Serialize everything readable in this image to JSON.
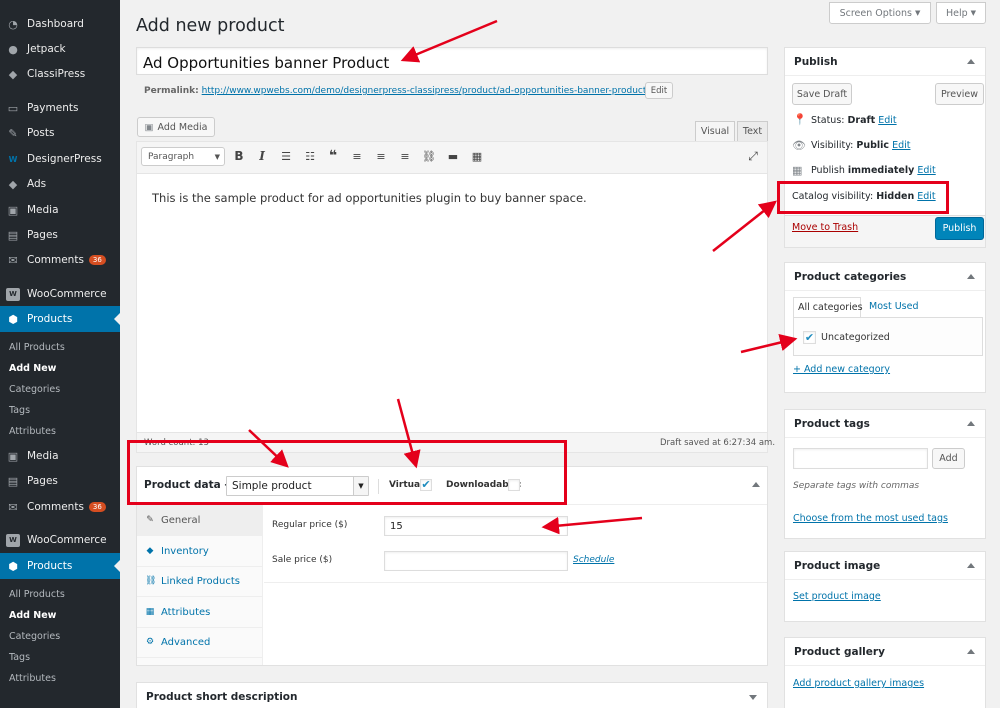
{
  "sidebar": {
    "items": [
      {
        "label": "Dashboard",
        "icon": "dashboard-icon",
        "glyph": "◔"
      },
      {
        "label": "Jetpack",
        "icon": "jetpack-icon",
        "glyph": "●"
      },
      {
        "label": "ClassiPress",
        "icon": "tag-icon",
        "glyph": "◆"
      },
      {
        "label": "Payments",
        "icon": "payments-icon",
        "glyph": "▭"
      },
      {
        "label": "Posts",
        "icon": "pin-icon",
        "glyph": "✎"
      },
      {
        "label": "DesignerPress",
        "icon": "designerpress-icon",
        "glyph": "W"
      },
      {
        "label": "Ads",
        "icon": "ads-tag-icon",
        "glyph": "◆"
      },
      {
        "label": "Media",
        "icon": "media-icon",
        "glyph": "▣"
      },
      {
        "label": "Pages",
        "icon": "pages-icon",
        "glyph": "▤"
      },
      {
        "label": "Comments",
        "icon": "comments-icon",
        "glyph": "✉",
        "badge": "36"
      },
      {
        "label": "WooCommerce",
        "icon": "woocommerce-icon",
        "glyph": "W"
      },
      {
        "label": "Products",
        "icon": "products-icon",
        "glyph": "⬢"
      }
    ],
    "submenu": [
      "All Products",
      "Add New",
      "Categories",
      "Tags",
      "Attributes"
    ],
    "items2": [
      {
        "label": "Media",
        "icon": "media-icon",
        "glyph": "▣"
      },
      {
        "label": "Pages",
        "icon": "pages-icon",
        "glyph": "▤"
      },
      {
        "label": "Comments",
        "icon": "comments-icon",
        "glyph": "✉",
        "badge": "36"
      },
      {
        "label": "WooCommerce",
        "icon": "woocommerce-icon",
        "glyph": "W"
      },
      {
        "label": "Products",
        "icon": "products-icon",
        "glyph": "⬢"
      }
    ],
    "submenu2": [
      "All Products",
      "Add New",
      "Categories",
      "Tags",
      "Attributes"
    ]
  },
  "top": {
    "screen_options": "Screen Options",
    "help": "Help"
  },
  "page_title": "Add new product",
  "title_value": "Ad Opportunities banner Product",
  "permalink": {
    "label": "Permalink:",
    "url": "http://www.wpwebs.com/demo/designerpress-classipress/product/ad-opportunities-banner-product/",
    "edit": "Edit"
  },
  "editor": {
    "add_media": "Add Media",
    "tab_visual": "Visual",
    "tab_text": "Text",
    "format": "Paragraph",
    "content": "This is the sample product for ad opportunities plugin to buy banner space.",
    "word_count": "Word count: 13",
    "draft_saved": "Draft saved at 6:27:34 am."
  },
  "product_data": {
    "label": "Product data —",
    "type": "Simple product",
    "virtual_label": "Virtual:",
    "virtual_checked": true,
    "downloadable_label": "Downloadable:",
    "downloadable_checked": false,
    "tabs": [
      {
        "label": "General",
        "icon": "wrench-icon",
        "glyph": "✎"
      },
      {
        "label": "Inventory",
        "icon": "inventory-icon",
        "glyph": "◆"
      },
      {
        "label": "Linked Products",
        "icon": "link-icon",
        "glyph": "⛓"
      },
      {
        "label": "Attributes",
        "icon": "attributes-icon",
        "glyph": "▦"
      },
      {
        "label": "Advanced",
        "icon": "gear-icon",
        "glyph": "⚙"
      }
    ],
    "regular_price_label": "Regular price ($)",
    "regular_price": "15",
    "sale_price_label": "Sale price ($)",
    "sale_price": "",
    "schedule": "Schedule"
  },
  "short_description": "Product short description",
  "publish": {
    "title": "Publish",
    "save_draft": "Save Draft",
    "preview": "Preview",
    "status_label": "Status:",
    "status": "Draft",
    "visibility_label": "Visibility:",
    "visibility": "Public",
    "publish_label": "Publish",
    "publish_when": "immediately",
    "catalog_label": "Catalog visibility:",
    "catalog": "Hidden",
    "edit": "Edit",
    "trash": "Move to Trash",
    "publish_button": "Publish"
  },
  "categories": {
    "title": "Product categories",
    "tab_all": "All categories",
    "tab_most": "Most Used",
    "item": "Uncategorized",
    "item_checked": true,
    "add_new": "+ Add new category"
  },
  "tags": {
    "title": "Product tags",
    "add": "Add",
    "hint": "Separate tags with commas",
    "choose": "Choose from the most used tags"
  },
  "image": {
    "title": "Product image",
    "set": "Set product image"
  },
  "gallery": {
    "title": "Product gallery",
    "add": "Add product gallery images"
  },
  "colors": {
    "sidebar": "#23282d",
    "active": "#0073aa",
    "annotation": "#e4001b",
    "link": "#0073aa"
  }
}
